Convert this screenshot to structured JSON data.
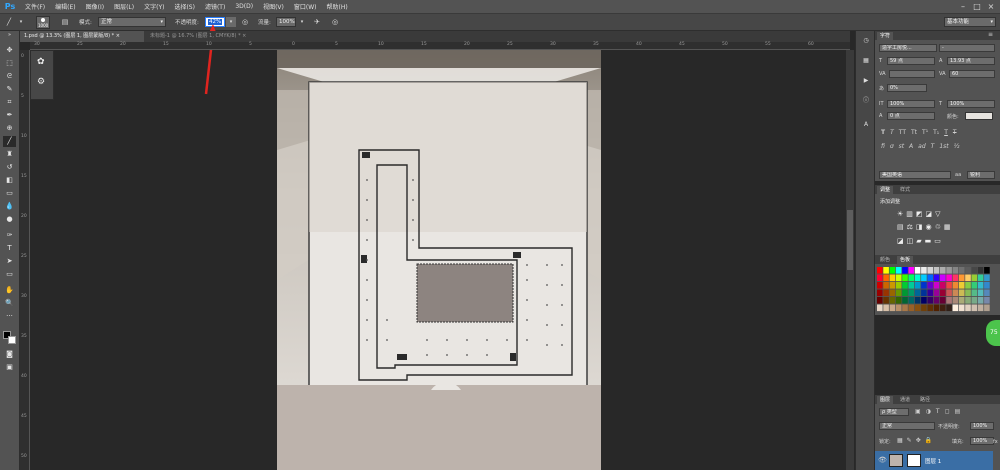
{
  "app": {
    "logo": "Ps"
  },
  "menu": [
    "文件(F)",
    "编辑(E)",
    "图像(I)",
    "图层(L)",
    "文字(Y)",
    "选择(S)",
    "滤镜(T)",
    "3D(D)",
    "视图(V)",
    "窗口(W)",
    "帮助(H)"
  ],
  "options": {
    "brush_size": "1000",
    "mode_label": "模式:",
    "mode_value": "正常",
    "opacity_label": "不透明度:",
    "opacity_value": "42%",
    "flow_label": "流量:",
    "flow_value": "100%",
    "workspace": "基本功能"
  },
  "tabs": [
    {
      "label": "1.psd @ 13.3% (图层 1, 图层蒙版/8) * ×",
      "active": true
    },
    {
      "label": "未标题-1 @ 16.7% (图层 1, CMYK/8) * ×",
      "active": false
    }
  ],
  "ruler_h": [
    "30",
    "25",
    "20",
    "15",
    "10",
    "5",
    "0",
    "5",
    "10",
    "15",
    "20",
    "25",
    "30",
    "35",
    "40",
    "45",
    "50",
    "55",
    "60"
  ],
  "ruler_v": [
    "0",
    "5",
    "10",
    "15",
    "20",
    "25",
    "30",
    "35",
    "40",
    "45",
    "50"
  ],
  "character_panel": {
    "title": "字符",
    "font_family": "造字工房悦...",
    "font_style": "-",
    "font_size": "59 点",
    "leading": "13.93 点",
    "kerning": "",
    "tracking": "60",
    "scale_pct": "0%",
    "vscale": "100%",
    "hscale": "100%",
    "baseline": "0 点",
    "color_label": "颜色:",
    "language": "美国英语",
    "aa": "锐利",
    "style_buttons": [
      "T",
      "T",
      "TT",
      "Tt",
      "T¹",
      "T₁",
      "T",
      "T"
    ],
    "ot_buttons": [
      "fi",
      "ơ",
      "st",
      "A",
      "ad",
      "T",
      "1st",
      "½"
    ]
  },
  "adjust_panel": {
    "tab1": "调整",
    "tab2": "样式",
    "add_label": "添加调整"
  },
  "swatch_panel": {
    "tab1": "颜色",
    "tab2": "色板"
  },
  "layers_panel": {
    "tab1": "图层",
    "tab2": "通道",
    "tab3": "路径",
    "kind": "ρ 类型",
    "blend": "正常",
    "opacity_label": "不透明度:",
    "opacity_value": "100%",
    "lock_label": "锁定:",
    "fill_label": "填充:",
    "fill_value": "100%",
    "layer_name": "图层 1",
    "fx": "fx"
  },
  "badge": "75"
}
